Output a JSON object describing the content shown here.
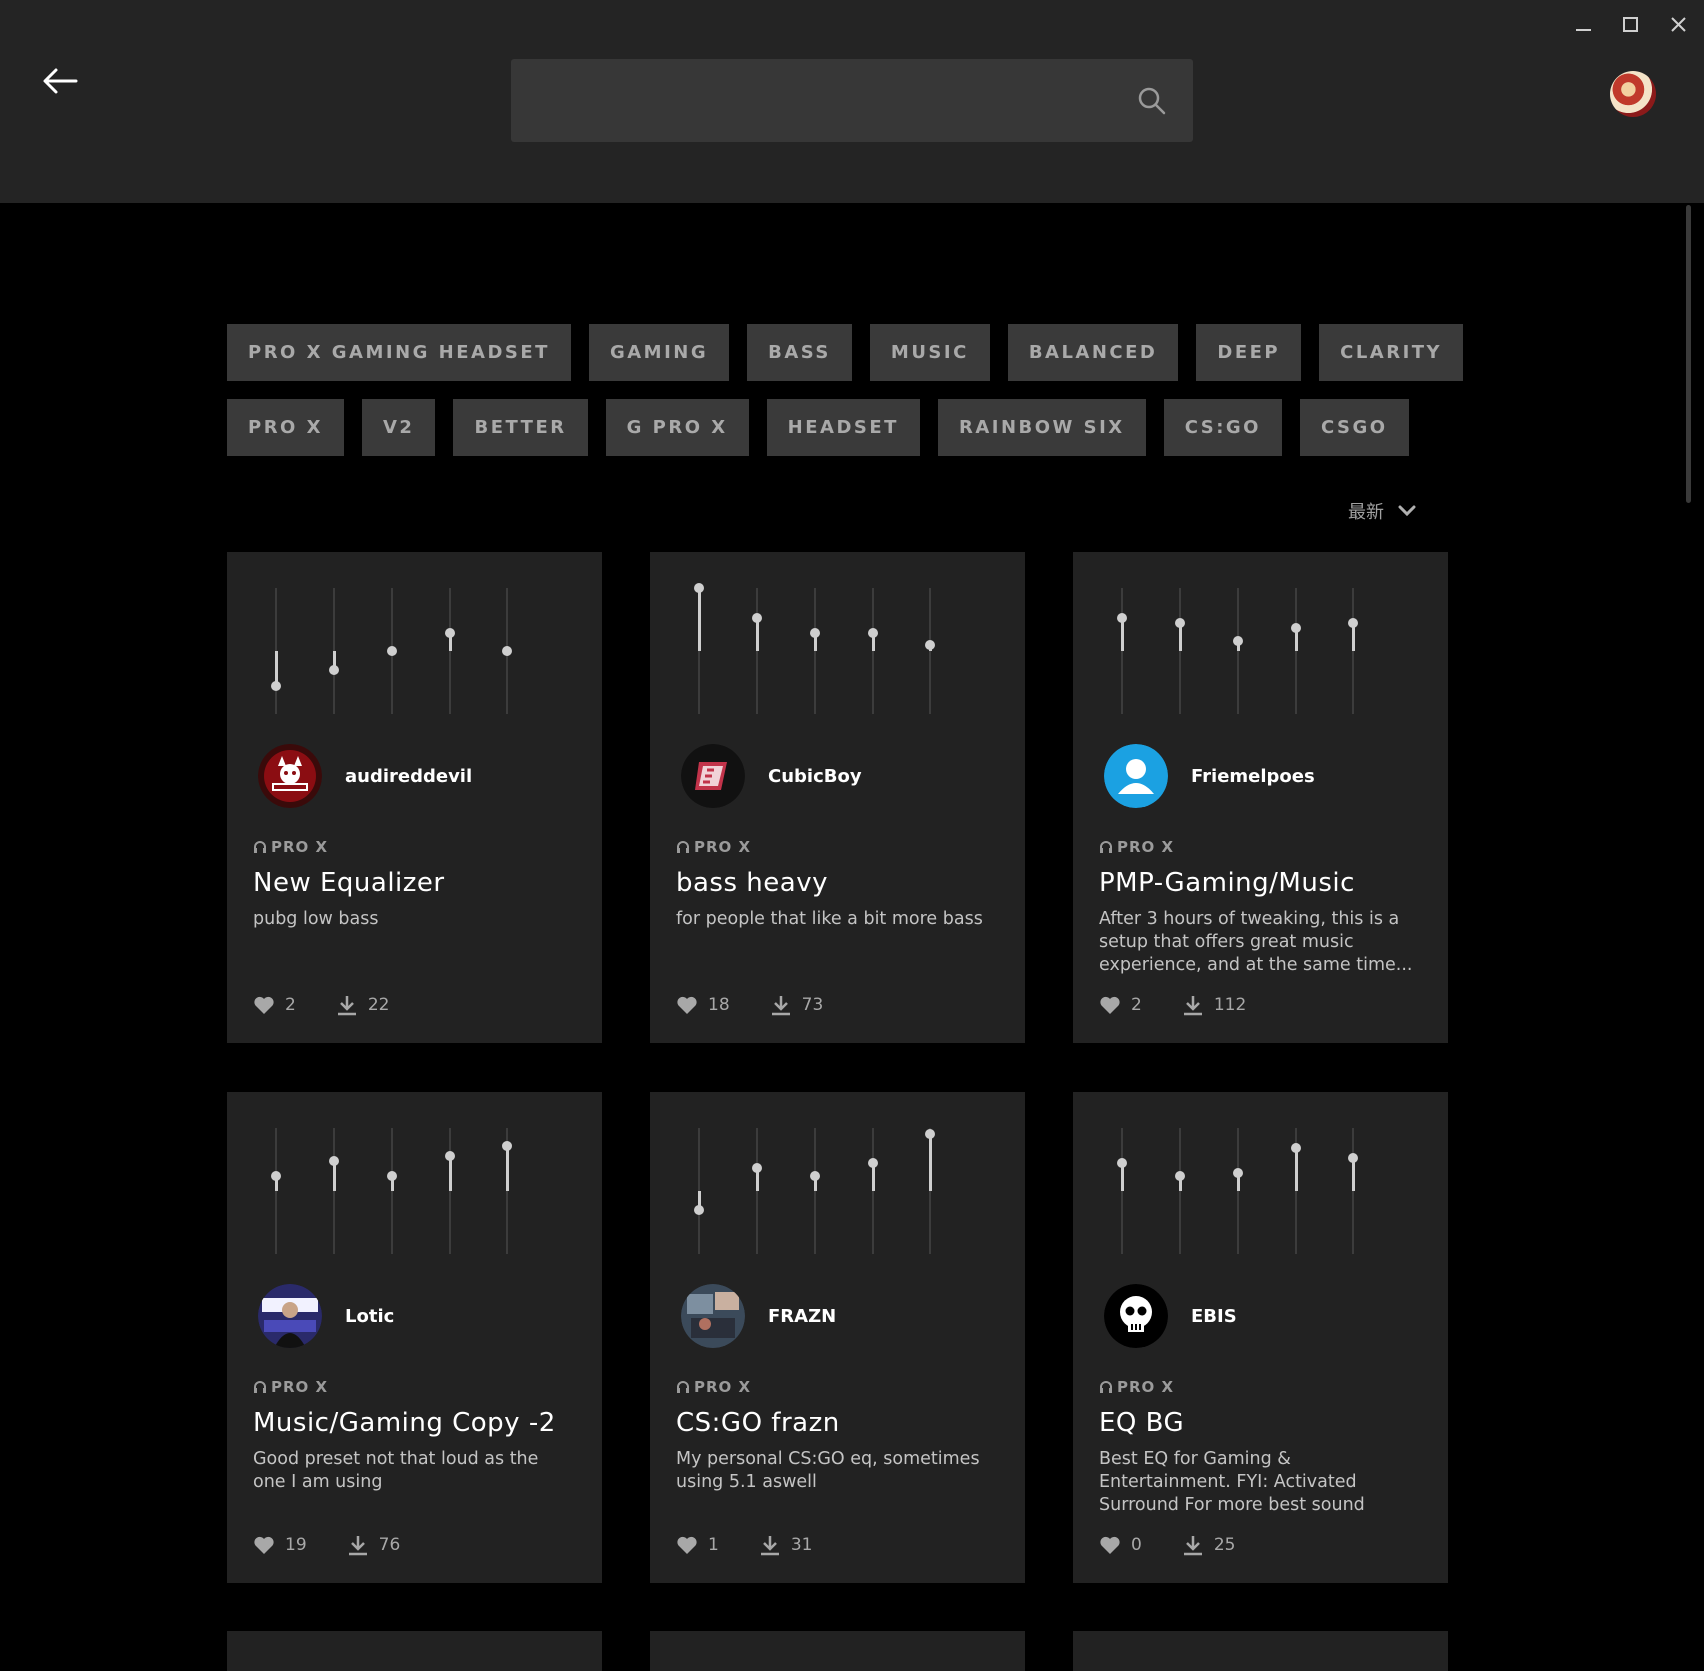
{
  "window": {
    "minimize_icon": "minimize-icon",
    "maximize_icon": "maximize-icon",
    "close_icon": "close-icon"
  },
  "header": {
    "back_icon": "arrow-left-icon",
    "search": {
      "placeholder": "",
      "icon": "search-icon"
    },
    "avatar": "user-avatar"
  },
  "tag_rows": [
    [
      "PRO X GAMING HEADSET",
      "GAMING",
      "BASS",
      "MUSIC",
      "BALANCED",
      "DEEP",
      "CLARITY"
    ],
    [
      "PRO X",
      "V2",
      "BETTER",
      "G PRO X",
      "HEADSET",
      "RAINBOW SIX",
      "CS:GO",
      "CSGO"
    ]
  ],
  "sort": {
    "label": "最新",
    "icon": "chevron-down-icon"
  },
  "presets": [
    {
      "user": "audireddevil",
      "avatar": "red-devil-logo",
      "device": "PRO X",
      "title": "New Equalizer",
      "description": "pubg low bass",
      "likes": "2",
      "downloads": "22",
      "eq_levels": [
        0.22,
        0.35,
        0.5,
        0.64,
        0.5
      ]
    },
    {
      "user": "CubicBoy",
      "avatar": "cb-logo",
      "device": "PRO X",
      "title": "bass heavy",
      "description": "for people that like a bit more bass",
      "likes": "18",
      "downloads": "73",
      "eq_levels": [
        1.0,
        0.76,
        0.64,
        0.64,
        0.55
      ]
    },
    {
      "user": "Friemelpoes",
      "avatar": "default-person",
      "device": "PRO X",
      "title": "PMP-Gaming/Music",
      "description": "After 3 hours of tweaking, this is a setup that offers great music experience, and at the same time...",
      "likes": "2",
      "downloads": "112",
      "eq_levels": [
        0.76,
        0.72,
        0.58,
        0.68,
        0.72
      ]
    },
    {
      "user": "Lotic",
      "avatar": "lotic-photo",
      "device": "PRO X",
      "title": "Music/Gaming Copy -2",
      "description": "Good preset not that loud as the one I am using",
      "likes": "19",
      "downloads": "76",
      "eq_levels": [
        0.62,
        0.74,
        0.62,
        0.78,
        0.86
      ]
    },
    {
      "user": "FRAZN",
      "avatar": "frazn-photo",
      "device": "PRO X",
      "title": "CS:GO frazn",
      "description": "My personal CS:GO eq, sometimes using 5.1 aswell",
      "likes": "1",
      "downloads": "31",
      "eq_levels": [
        0.35,
        0.68,
        0.62,
        0.72,
        0.95
      ]
    },
    {
      "user": "EBIS",
      "avatar": "skull-icon",
      "device": "PRO X",
      "title": "EQ BG",
      "description": "Best EQ for Gaming & Entertainment. FYI: Activated Surround For more best sound",
      "likes": "0",
      "downloads": "25",
      "eq_levels": [
        0.72,
        0.62,
        0.64,
        0.84,
        0.76
      ]
    }
  ],
  "colors": {
    "topbar": "#242424",
    "background": "#000000",
    "card": "#222222",
    "tag": "#3a3a3a",
    "accent_avatar": "#1ba1e2"
  }
}
